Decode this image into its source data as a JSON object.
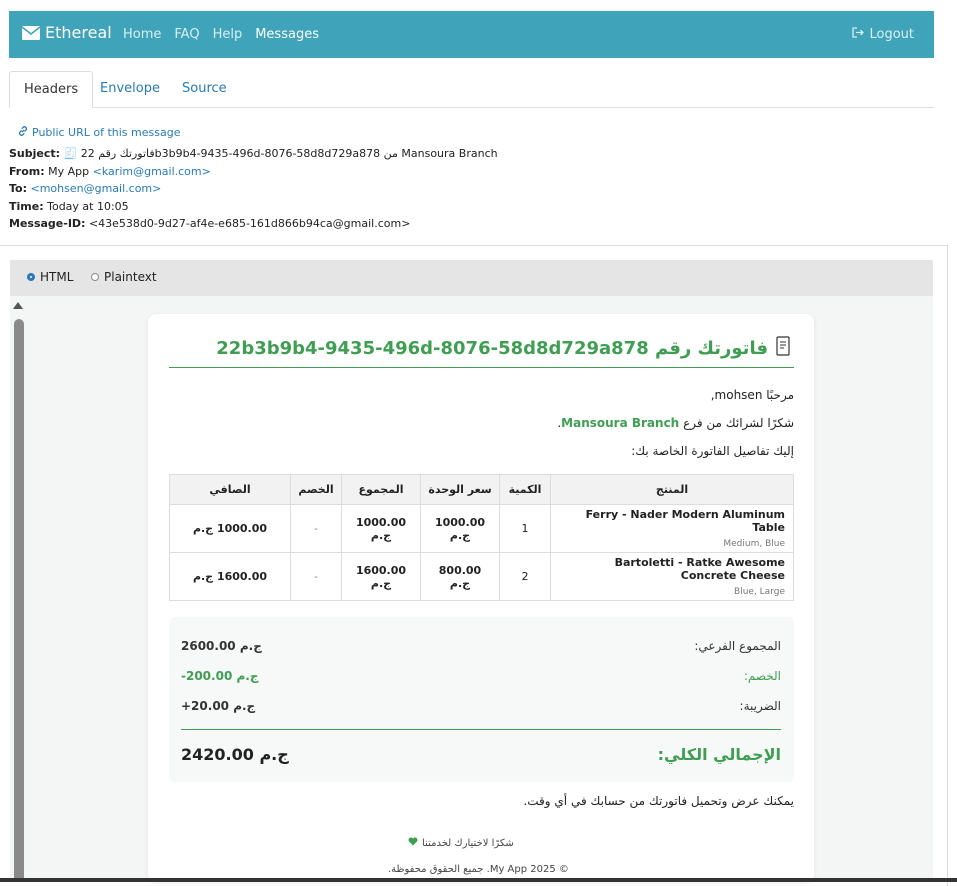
{
  "navbar": {
    "brand": "Ethereal",
    "links": [
      "Home",
      "FAQ",
      "Help",
      "Messages"
    ],
    "active_link": "Messages",
    "logout": "Logout",
    "bg_color": "#3fa3b9"
  },
  "tabs": [
    "Headers",
    "Envelope",
    "Source"
  ],
  "active_tab": "Headers",
  "headers": {
    "public_url": "Public URL of this message",
    "subject_label": "Subject:",
    "subject_value": "🧾 فاتورتك رقم 22b3b9b4-9435-496d-8076-58d8d729a878 من Mansoura Branch",
    "from_label": "From:",
    "from_name": "My App",
    "from_email": "<karim@gmail.com>",
    "to_label": "To:",
    "to_email": "<mohsen@gmail.com>",
    "time_label": "Time:",
    "time_value": "Today at 10:05",
    "message_id_label": "Message-ID:",
    "message_id_value": "<43e538d0-9d27-af4e-e685-161d866b94ca@gmail.com>"
  },
  "view_mode": {
    "options": [
      "HTML",
      "Plaintext"
    ],
    "selected": "HTML"
  },
  "email": {
    "title": "فاتورتك رقم 22b3b9b4-9435-496d-8076-58d8d729a878",
    "greeting": "مرحبًا mohsen,",
    "thanks_line_prefix": "شكرًا لشرائك من فرع",
    "branch": "Mansoura Branch",
    "intro": "إليك تفاصيل الفاتورة الخاصة بك:",
    "table": {
      "headers": [
        "المنتج",
        "الكمية",
        "سعر الوحدة",
        "المجموع",
        "الخصم",
        "الصافي"
      ],
      "rows": [
        {
          "product": "Ferry - Nader Modern Aluminum Table",
          "variant": "Medium, Blue",
          "qty": "1",
          "unit_price": "1000.00 ج.م",
          "total": "1000.00 ج.م",
          "discount": "-",
          "net": "1000.00 ج.م"
        },
        {
          "product": "Bartoletti - Ratke Awesome Concrete Cheese",
          "variant": "Blue, Large",
          "qty": "2",
          "unit_price": "800.00 ج.م",
          "total": "1600.00 ج.م",
          "discount": "-",
          "net": "1600.00 ج.م"
        }
      ]
    },
    "totals": {
      "subtotal_label": "المجموع الفرعي:",
      "subtotal_value": "2600.00 ج.م",
      "discount_label": "الخصم:",
      "discount_value": "-200.00 ج.م",
      "tax_label": "الضريبة:",
      "tax_value": "+20.00 ج.م",
      "grand_label": "الإجمالي الكلي:",
      "grand_value": "2420.00 ج.م"
    },
    "footer_note": "يمكنك عرض وتحميل فاتورتك من حسابك في أي وقت.",
    "thanks_footer": "شكرًا لاختيارك لخدمتنا",
    "copyright": "© 2025 My App. جميع الحقوق محفوظة."
  },
  "colors": {
    "accent_green": "#3f9e52",
    "link_blue": "#2a7ab8"
  }
}
